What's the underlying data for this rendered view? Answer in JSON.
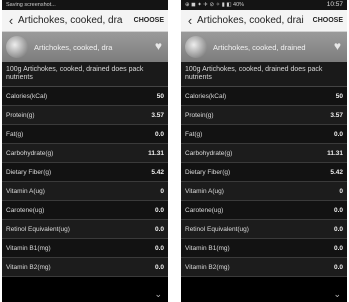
{
  "left": {
    "status": "Saving screenshot...",
    "time": "",
    "title": "Artichokes, cooked, dra",
    "choose": "CHOOSE",
    "banner_label": "Artichokes, cooked, dra",
    "desc": "100g Artichokes, cooked, drained does pack nutrients"
  },
  "right": {
    "status": "⊕ ◼ ✦  ✈ ⊘ ✧ ▮ ◧ 40%",
    "time": "10:57",
    "title": "Artichokes, cooked, drai",
    "choose": "CHOOSE",
    "banner_label": "Artichokes, cooked, drained",
    "desc": "100g Artichokes, cooked, drained does pack nutrients"
  },
  "nutrients": [
    {
      "name": "Calories(kCal)",
      "value": "50"
    },
    {
      "name": "Protein(g)",
      "value": "3.57"
    },
    {
      "name": "Fat(g)",
      "value": "0.0"
    },
    {
      "name": "Carbohydrate(g)",
      "value": "11.31"
    },
    {
      "name": "Dietary Fiber(g)",
      "value": "5.42"
    },
    {
      "name": "Vitamin A(ug)",
      "value": "0"
    },
    {
      "name": "Carotene(ug)",
      "value": "0.0"
    },
    {
      "name": "Retinol Equivalent(ug)",
      "value": "0.0"
    },
    {
      "name": "Vitamin B1(mg)",
      "value": "0.0"
    },
    {
      "name": "Vitamin B2(mg)",
      "value": "0.0"
    }
  ]
}
